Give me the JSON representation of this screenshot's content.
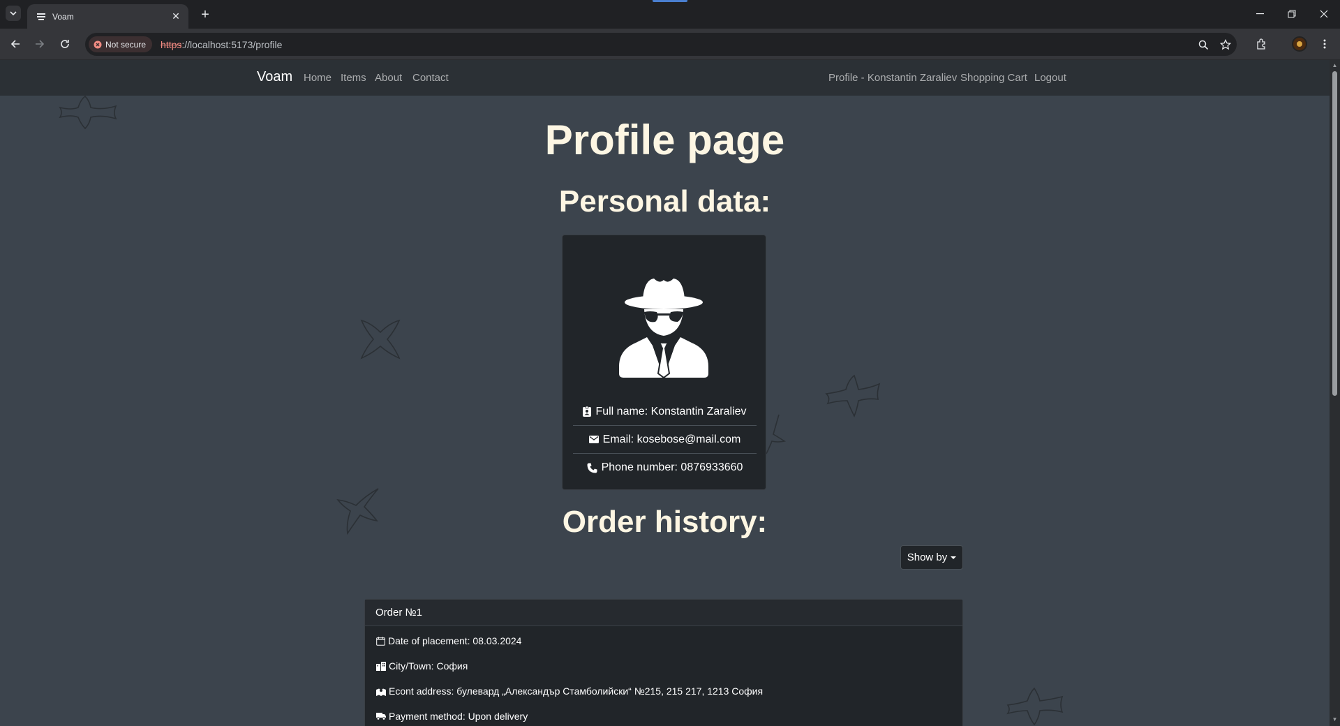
{
  "browser": {
    "tab_title": "Voam",
    "security_label": "Not secure",
    "url_scheme": "https",
    "url_rest": "://localhost:5173/profile"
  },
  "navbar": {
    "brand": "Voam",
    "left_links": [
      "Home",
      "Items",
      "About",
      "Contact"
    ],
    "right_links": [
      "Profile - Konstantin Zaraliev",
      "Shopping Cart",
      "Logout"
    ]
  },
  "page": {
    "title": "Profile page",
    "personal_heading": "Personal data:",
    "order_heading": "Order history:"
  },
  "profile": {
    "full_name": "Full name: Konstantin Zaraliev",
    "email": "Email: kosebose@mail.com",
    "phone": "Phone number: 0876933660"
  },
  "orders": {
    "show_by_label": "Show by",
    "items": [
      {
        "title": "Order №1",
        "date": "Date of placement: 08.03.2024",
        "city": "City/Town: София",
        "address": "Econt address: булевард „Александър Стамболийски“ №215, 215 217, 1213 София",
        "payment": "Payment method: Upon delivery"
      }
    ]
  },
  "colors": {
    "page_bg": "#3c444d",
    "navbar_bg": "#2b3035",
    "card_bg": "#212529",
    "heading": "#fdf6e3"
  }
}
